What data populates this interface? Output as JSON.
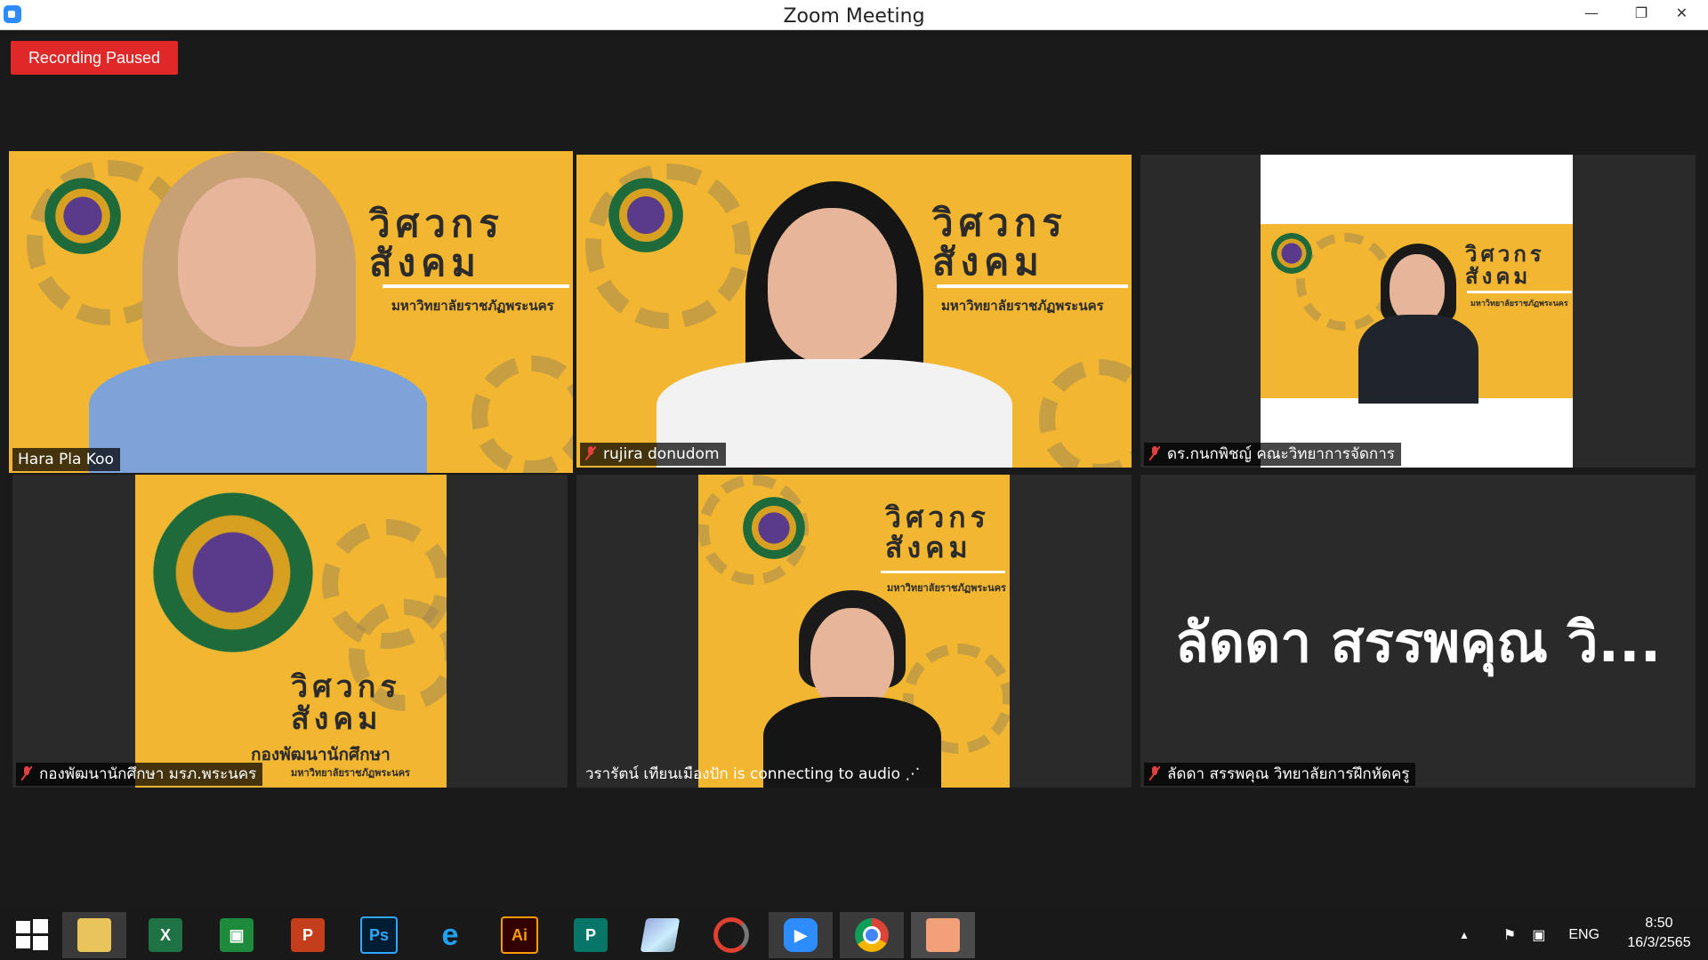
{
  "window": {
    "title": "Zoom Meeting",
    "minimize": "—",
    "maximize": "❐",
    "close": "✕"
  },
  "recording": {
    "label": "Recording Paused"
  },
  "banner": {
    "headline_1": "วิศวกร",
    "headline_2": "สังคม",
    "university": "มหาวิทยาลัยราชภัฏพระนคร",
    "division": "กองพัฒนานักศึกษา"
  },
  "participants": [
    {
      "name": "Hara Pla Koo",
      "muted": false,
      "active": true
    },
    {
      "name": "rujira donudom",
      "muted": true,
      "active": false
    },
    {
      "name": "ดร.กนกพิชญ์ คณะวิทยาการจัดการ",
      "muted": true,
      "active": false
    },
    {
      "name": "กองพัฒนานักศึกษา มรภ.พระนคร",
      "muted": true,
      "active": false
    },
    {
      "name": "วรารัตน์ เทียนเมืองปัก is connecting to audio ⋰",
      "muted": false,
      "active": false
    },
    {
      "name": "ลัดดา สรรพคุณ วิทยาลัยการฝึกหัดครู",
      "muted": true,
      "active": false,
      "display_name": "ลัดดา สรรพคุณ วิ..."
    }
  ],
  "taskbar": {
    "apps": [
      {
        "icon": "windows-start-icon",
        "label": ""
      },
      {
        "icon": "file-explorer-icon",
        "label": ""
      },
      {
        "icon": "excel-icon",
        "label": "X"
      },
      {
        "icon": "store-icon",
        "label": ""
      },
      {
        "icon": "powerpoint-icon",
        "label": "P"
      },
      {
        "icon": "photoshop-icon",
        "label": "Ps"
      },
      {
        "icon": "internet-explorer-icon",
        "label": "e"
      },
      {
        "icon": "illustrator-icon",
        "label": "Ai"
      },
      {
        "icon": "publisher-icon",
        "label": "P"
      },
      {
        "icon": "notepad-icon",
        "label": ""
      },
      {
        "icon": "photoscape-icon",
        "label": ""
      },
      {
        "icon": "zoom-icon",
        "label": ""
      },
      {
        "icon": "chrome-icon",
        "label": ""
      },
      {
        "icon": "image-viewer-icon",
        "label": ""
      }
    ],
    "tray": {
      "language": "ENG",
      "time": "8:50",
      "date": "16/3/2565"
    },
    "colors": {
      "excel": "#1f7244",
      "store": "#1e8a3c",
      "powerpoint": "#c43e1c",
      "photoshop": "#001d34",
      "illustrator": "#ff9a00",
      "publisher": "#077568",
      "zoom": "#2d8cff"
    }
  }
}
